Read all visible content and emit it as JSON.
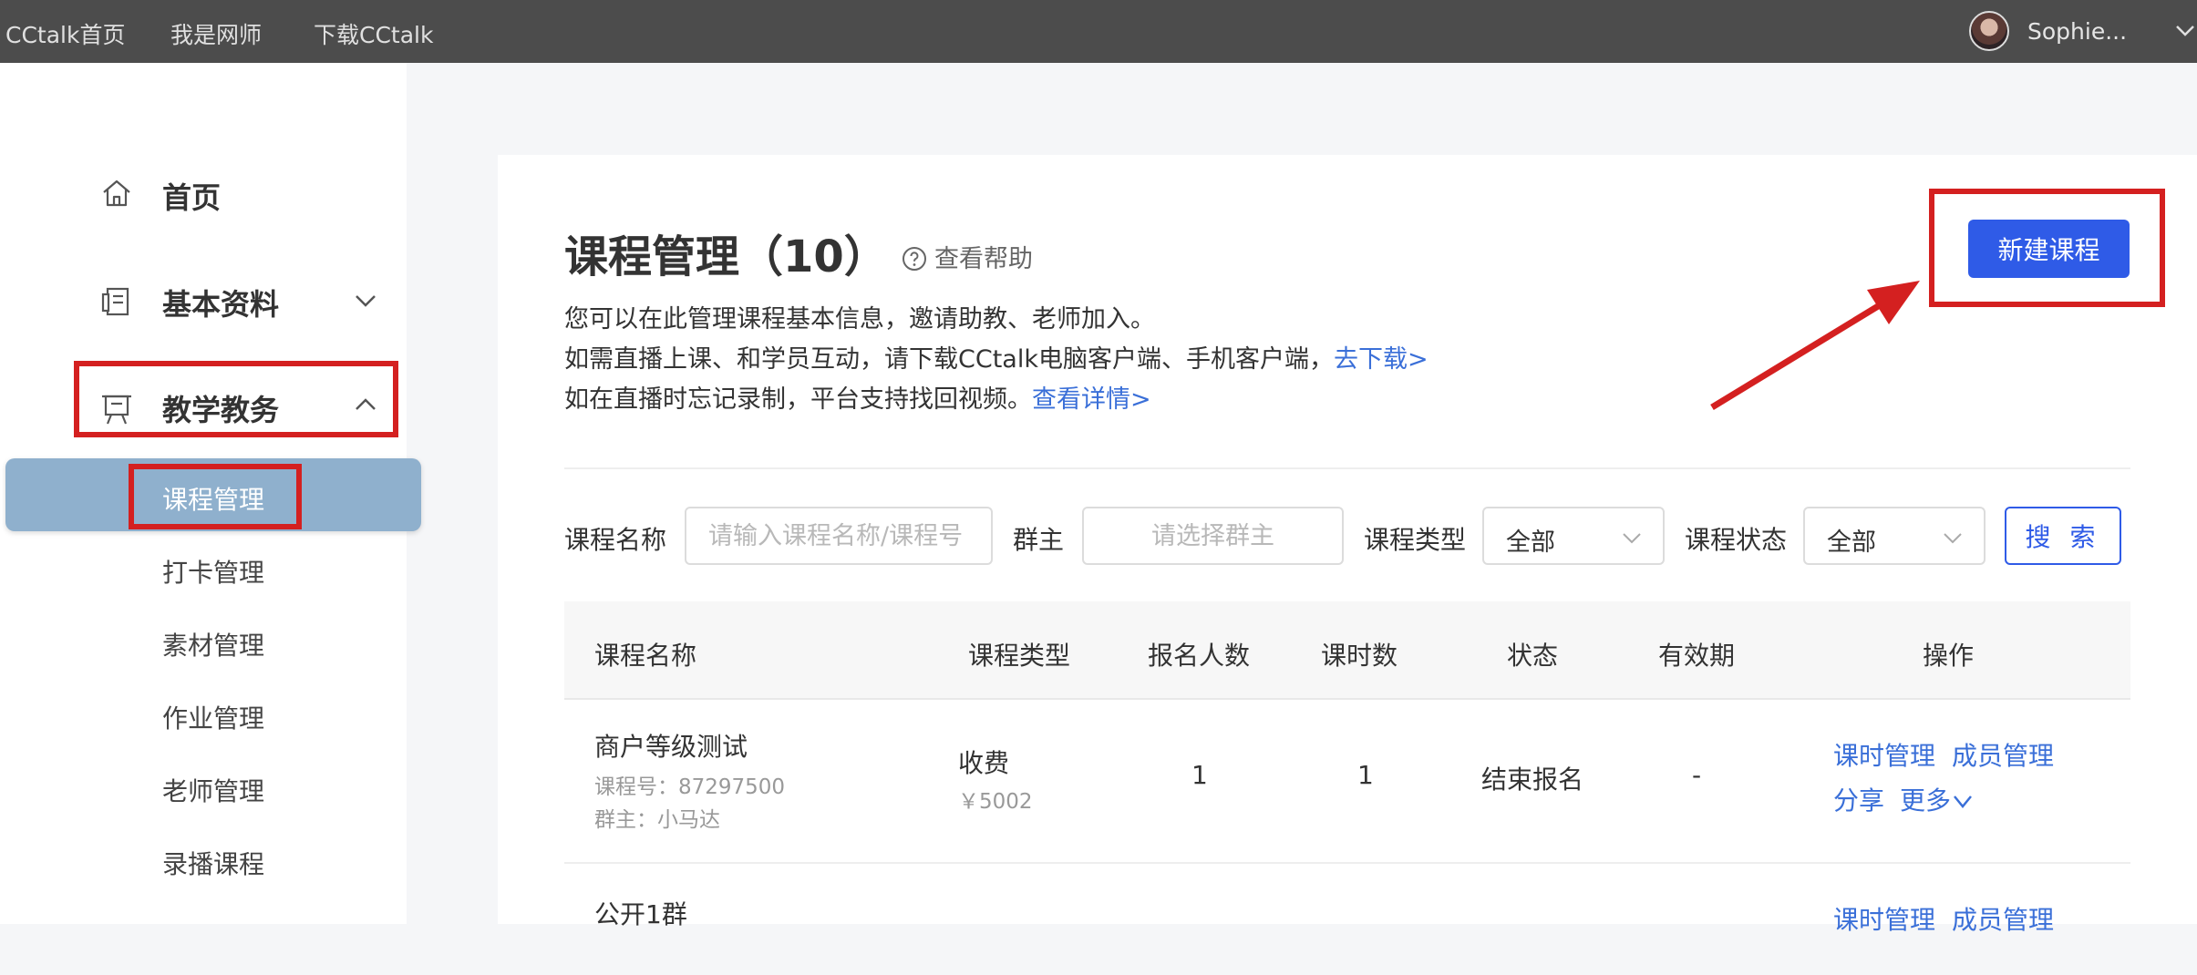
{
  "topbar": {
    "links": [
      "CCtalk首页",
      "我是网师",
      "下载CCtalk"
    ],
    "username": "Sophie..."
  },
  "sidebar": {
    "items": [
      {
        "label": "首页",
        "icon": "home-icon"
      },
      {
        "label": "基本资料",
        "icon": "profile-doc-icon"
      },
      {
        "label": "教学教务",
        "icon": "teaching-board-icon"
      }
    ],
    "sub_items": [
      "课程管理",
      "打卡管理",
      "素材管理",
      "作业管理",
      "老师管理",
      "录播课程"
    ]
  },
  "main": {
    "title": "课程管理（10）",
    "help": "查看帮助",
    "desc1": "您可以在此管理课程基本信息，邀请助教、老师加入。",
    "desc2": "如需直播上课、和学员互动，请下载CCtalk电脑客户端、手机客户端，",
    "desc2_link": "去下载>",
    "desc3": "如在直播时忘记录制，平台支持找回视频。",
    "desc3_link": "查看详情>",
    "new_button": "新建课程"
  },
  "filters": {
    "name_label": "课程名称",
    "name_placeholder": "请输入课程名称/课程号",
    "owner_label": "群主",
    "owner_placeholder": "请选择群主",
    "type_label": "课程类型",
    "type_value": "全部",
    "status_label": "课程状态",
    "status_value": "全部",
    "search_button": "搜 索"
  },
  "table": {
    "headers": [
      "课程名称",
      "课程类型",
      "报名人数",
      "课时数",
      "状态",
      "有效期",
      "操作"
    ],
    "rows": [
      {
        "name": "商户等级测试",
        "course_no": "课程号：87297500",
        "owner": "群主：小马达",
        "type": "收费",
        "price": "￥5002",
        "enrolled": "1",
        "lessons": "1",
        "status": "结束报名",
        "validity": "-",
        "actions": [
          "课时管理",
          "成员管理",
          "分享",
          "更多"
        ]
      },
      {
        "name": "公开1群",
        "actions": [
          "课时管理",
          "成员管理"
        ]
      }
    ]
  },
  "colors": {
    "topbar": "#4c4c4c",
    "accent": "#2f5be7",
    "link": "#3a6fd8",
    "annotation": "#d42020",
    "active_sub_bg": "#8fb0cd"
  }
}
